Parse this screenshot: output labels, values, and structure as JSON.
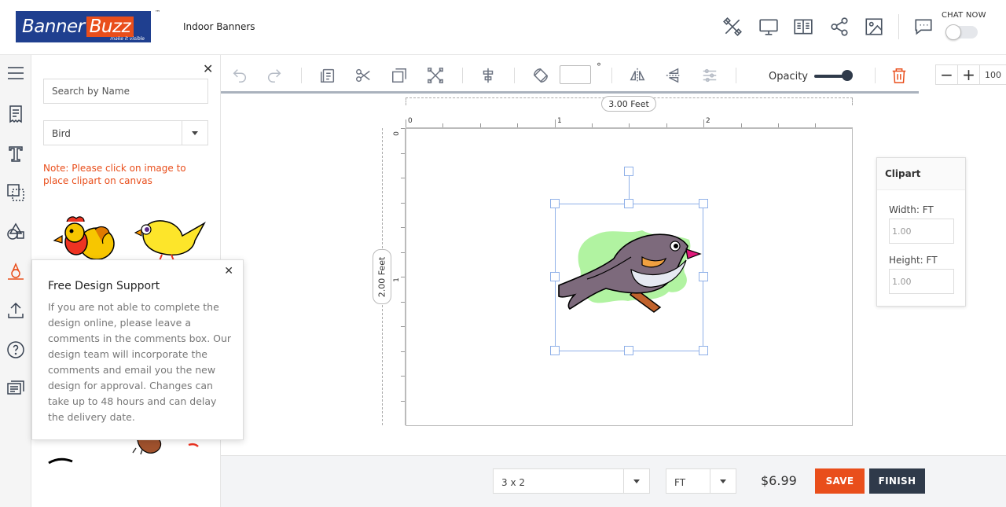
{
  "header": {
    "brand_part1": "Banner",
    "brand_part2": "Buzz",
    "brand_tagline": "make it visible",
    "brand_tm": "™",
    "breadcrumb": "Indoor Banners",
    "chat_label": "CHAT NOW"
  },
  "panel": {
    "search_placeholder": "Search by Name",
    "category_selected": "Bird",
    "note": "Note: Please click on image to place clipart on canvas"
  },
  "popup": {
    "title": "Free Design Support",
    "body": "If you are not able to complete the design online, please leave a comments in the comments box. Our design team will incorporate the comments and email you the new design for approval. Changes can take up to 48 hours and can delay the delivery date."
  },
  "toolbar": {
    "degree_symbol": "°",
    "opacity_label": "Opacity",
    "opacity_value": 1.0,
    "zoom_value": "100"
  },
  "canvas": {
    "width_label": "3.00 Feet",
    "height_label": "2.00 Feet",
    "ruler_h": [
      "0",
      "1",
      "2"
    ],
    "ruler_v": [
      "0",
      "1"
    ]
  },
  "props": {
    "title": "Clipart",
    "width_label": "Width: FT",
    "width_value": "1.00",
    "height_label": "Height: FT",
    "height_value": "1.00"
  },
  "bottom": {
    "size_selected": "3 x 2",
    "unit_selected": "FT",
    "price": "$6.99",
    "save_label": "SAVE",
    "finish_label": "FINISH"
  },
  "colors": {
    "brand_blue": "#1f3f8f",
    "accent_orange": "#e94e1b",
    "dark": "#2f3a4a"
  },
  "icons": {
    "header": [
      "design-tools-icon",
      "monitor-icon",
      "templates-icon",
      "share-icon",
      "image-icon",
      "chat-icon"
    ],
    "rail": [
      "menu-icon",
      "document-icon",
      "text-icon",
      "layers-icon",
      "shapes-icon",
      "clipart-icon",
      "upload-icon",
      "help-icon",
      "comments-icon"
    ]
  }
}
